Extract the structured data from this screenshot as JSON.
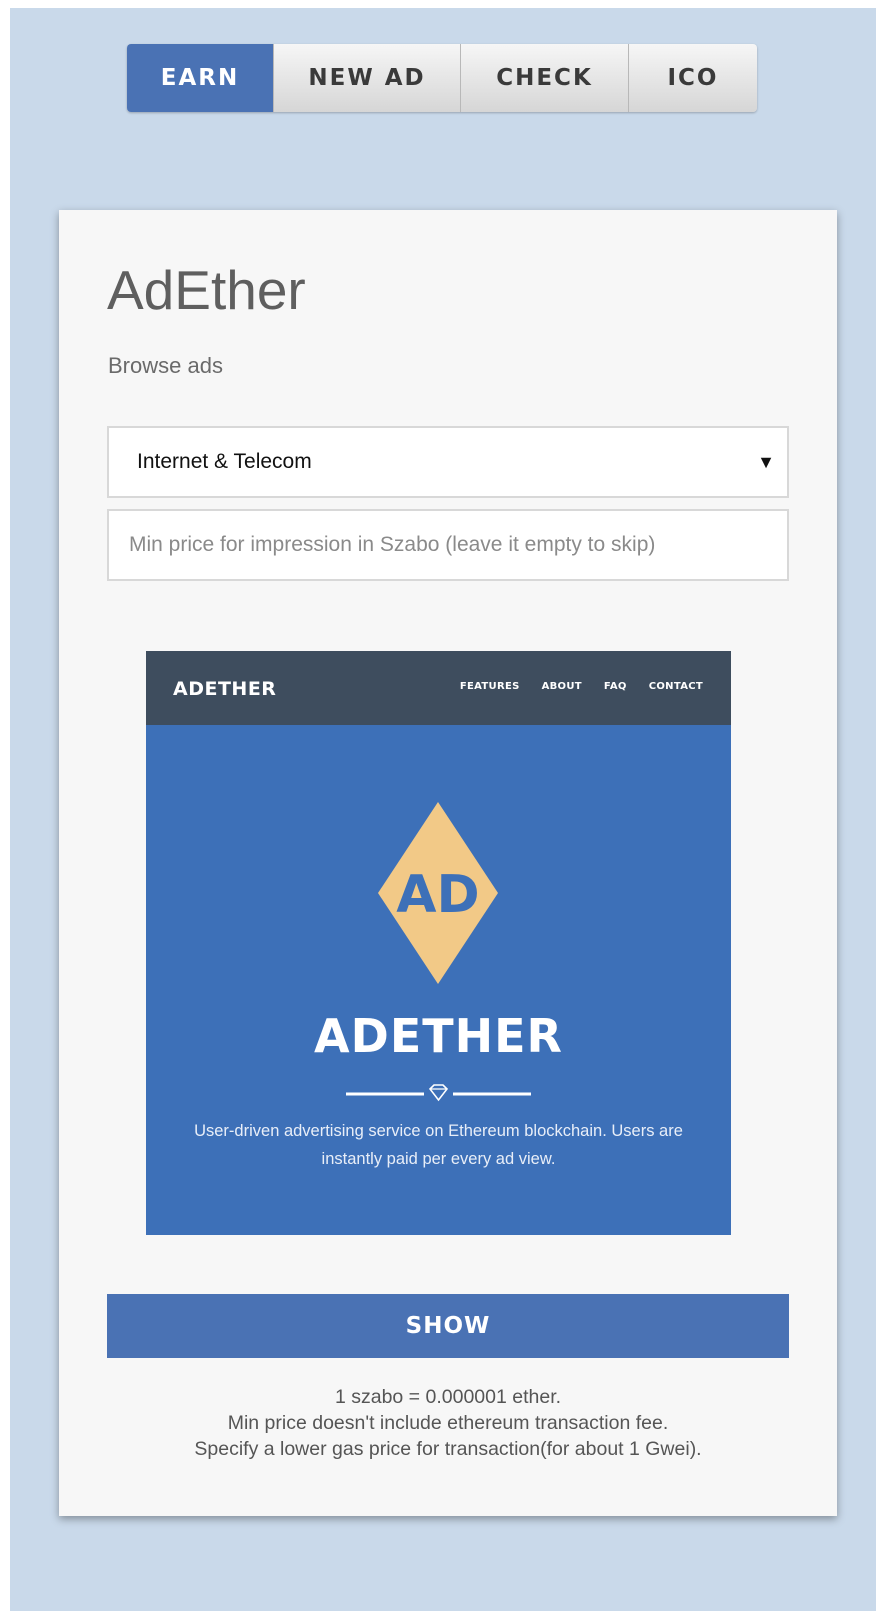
{
  "tabs": [
    {
      "label": "EARN",
      "active": true
    },
    {
      "label": "NEW AD",
      "active": false
    },
    {
      "label": "CHECK",
      "active": false
    },
    {
      "label": "ICO",
      "active": false
    }
  ],
  "card": {
    "title": "AdEther",
    "subtitle": "Browse ads",
    "category_select": {
      "value": "Internet & Telecom"
    },
    "min_price_input": {
      "value": "",
      "placeholder": "Min price for impression in Szabo (leave it empty to skip)"
    },
    "ad": {
      "nav_logo": "ADETHER",
      "nav_links": [
        "FEATURES",
        "ABOUT",
        "FAQ",
        "CONTACT"
      ],
      "emblem_text": "AD",
      "headline": "ADETHER",
      "description": "User-driven advertising service on Ethereum blockchain. Users are instantly paid per every ad view."
    },
    "show_button": "SHOW",
    "notes": [
      "1 szabo = 0.000001 ether.",
      "Min price doesn't include ethereum transaction fee.",
      "Specify a lower gas price for transaction(for about 1 Gwei)."
    ]
  },
  "colors": {
    "page_bg": "#c9d9ea",
    "accent": "#4a72b4",
    "ad_blue": "#3d70b8",
    "ad_nav": "#3e4d5e",
    "emblem_gold": "#f2c987"
  },
  "icons": {
    "dropdown": "triangle-down-icon",
    "divider": "diamond-gem-icon"
  }
}
